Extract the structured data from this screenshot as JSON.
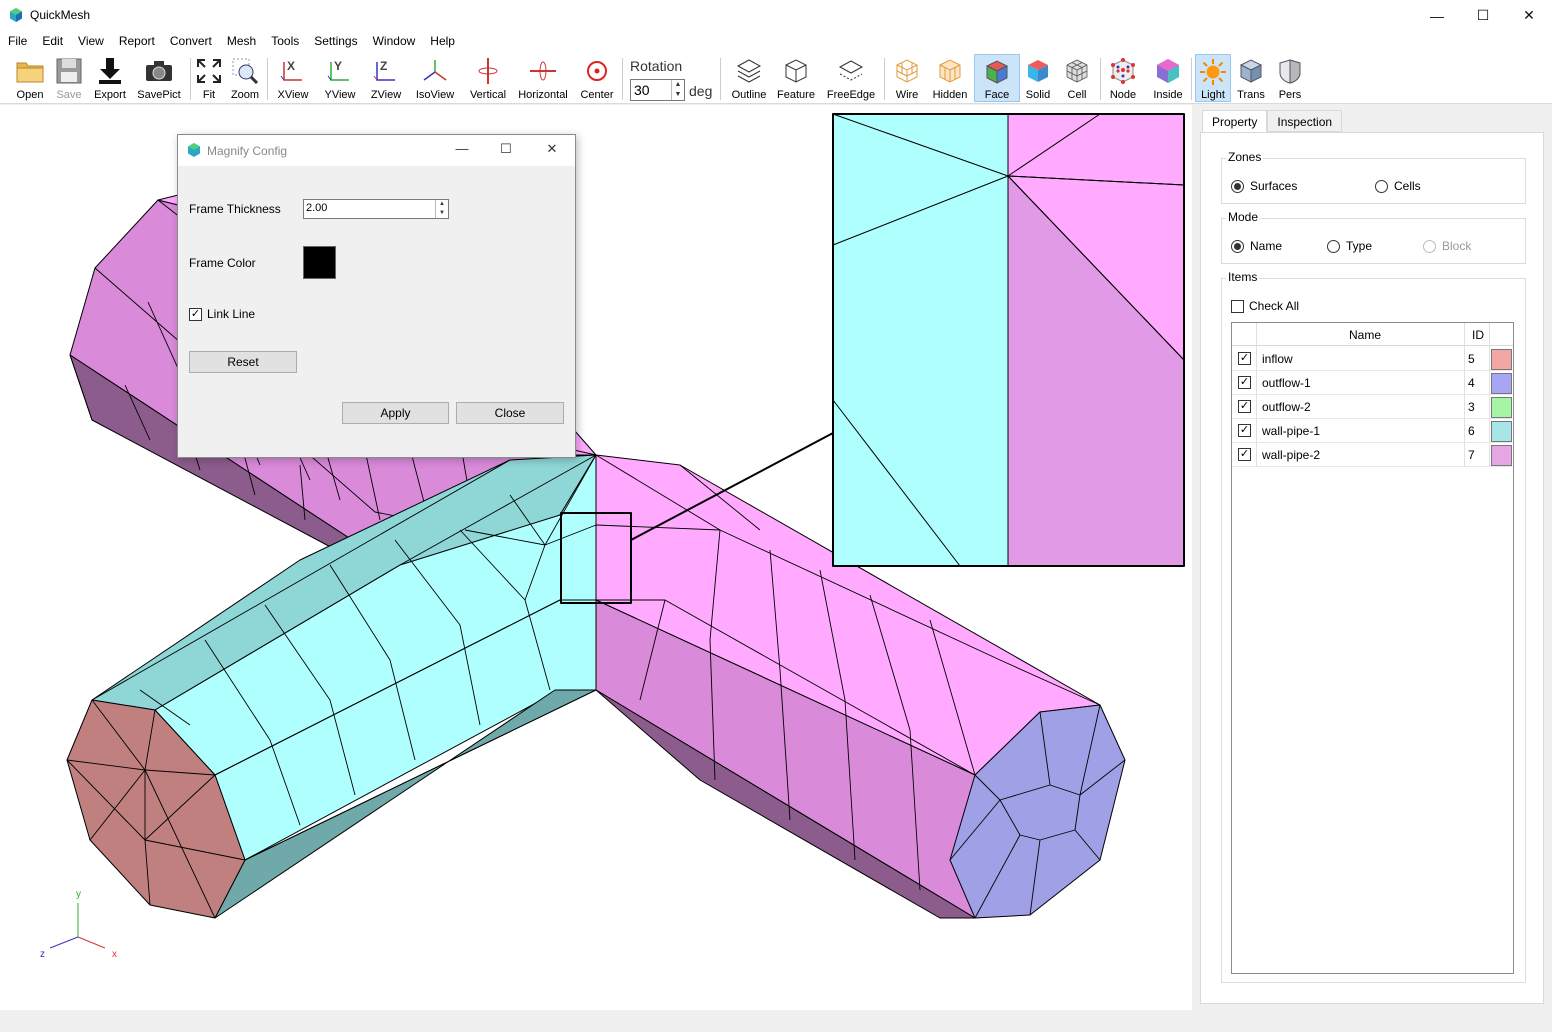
{
  "window": {
    "title": "QuickMesh",
    "minimize": "—",
    "maximize": "☐",
    "close": "✕"
  },
  "menu": [
    "File",
    "Edit",
    "View",
    "Report",
    "Convert",
    "Mesh",
    "Tools",
    "Settings",
    "Window",
    "Help"
  ],
  "toolbar": {
    "open": "Open",
    "save": "Save",
    "export": "Export",
    "savepict": "SavePict",
    "fit": "Fit",
    "zoom": "Zoom",
    "xview": "XView",
    "yview": "YView",
    "zview": "ZView",
    "isoview": "IsoView",
    "vertical": "Vertical",
    "horizontal": "Horizontal",
    "center": "Center",
    "rotation_label": "Rotation",
    "rotation_value": "30",
    "rotation_unit": "deg",
    "outline": "Outline",
    "feature": "Feature",
    "freeedge": "FreeEdge",
    "wire": "Wire",
    "hidden": "Hidden",
    "face": "Face",
    "solid": "Solid",
    "cell": "Cell",
    "node": "Node",
    "inside": "Inside",
    "light": "Light",
    "trans": "Trans",
    "pers": "Pers"
  },
  "dialog": {
    "title": "Magnify Config",
    "frame_thickness_label": "Frame Thickness",
    "frame_thickness_value": "2.00",
    "frame_color_label": "Frame Color",
    "frame_color": "#000000",
    "link_line_label": "Link Line",
    "link_line_checked": true,
    "reset": "Reset",
    "apply": "Apply",
    "close": "Close"
  },
  "panel": {
    "tabs": [
      "Property",
      "Inspection"
    ],
    "zones": {
      "title": "Zones",
      "surfaces": "Surfaces",
      "cells": "Cells",
      "selected": "Surfaces"
    },
    "mode": {
      "title": "Mode",
      "name": "Name",
      "type": "Type",
      "block": "Block",
      "selected": "Name"
    },
    "items": {
      "title": "Items",
      "check_all": "Check All",
      "col_name": "Name",
      "col_id": "ID",
      "rows": [
        {
          "name": "inflow",
          "id": "5",
          "color": "#f4a6a6",
          "checked": true
        },
        {
          "name": "outflow-1",
          "id": "4",
          "color": "#a6a6f4",
          "checked": true
        },
        {
          "name": "outflow-2",
          "id": "3",
          "color": "#a6f4a6",
          "checked": true
        },
        {
          "name": "wall-pipe-1",
          "id": "6",
          "color": "#a6e6e6",
          "checked": true
        },
        {
          "name": "wall-pipe-2",
          "id": "7",
          "color": "#e6a6e6",
          "checked": true
        }
      ]
    }
  },
  "axes": {
    "y": "y",
    "z": "z",
    "x": "x"
  },
  "colors": {
    "pipe1": "#afffff",
    "pipe1_dark": "#8fd6d6",
    "pipe1_darker": "#6fa9a9",
    "pipe2": "#ffaaff",
    "pipe2_mid": "#d98ad9",
    "pipe2_dark": "#8c5c8c",
    "inflow": "#c08080",
    "outflow": "#a0a0e6"
  }
}
